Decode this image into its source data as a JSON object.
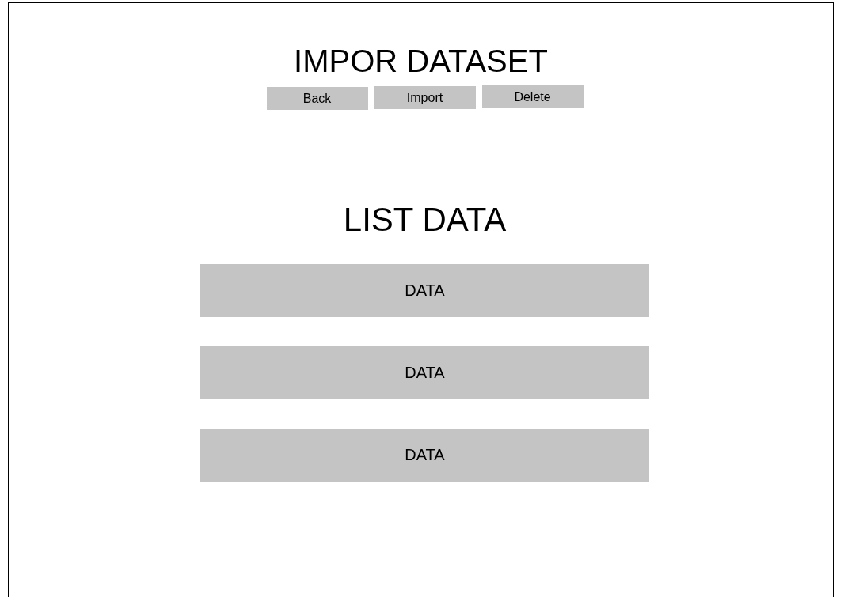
{
  "title": "IMPOR DATASET",
  "buttons": [
    {
      "label": "Back"
    },
    {
      "label": "Import"
    },
    {
      "label": "Delete"
    }
  ],
  "list_title": "LIST DATA",
  "items": [
    {
      "label": "DATA"
    },
    {
      "label": "DATA"
    },
    {
      "label": "DATA"
    }
  ]
}
